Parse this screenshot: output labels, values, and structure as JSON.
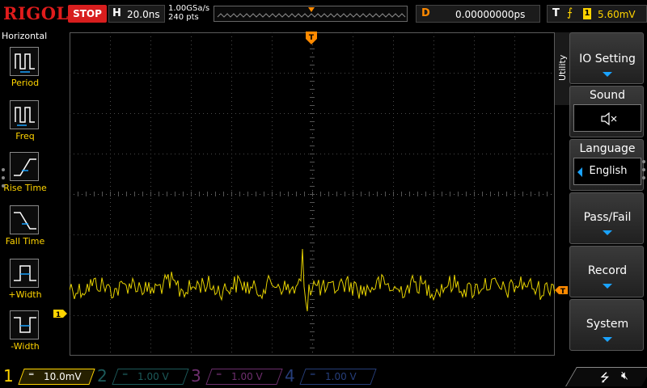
{
  "header": {
    "brand": "RIGOL",
    "run_state": "STOP",
    "horizontal": {
      "letter": "H",
      "timebase": "20.0ns"
    },
    "sample_rate": "1.00GSa/s",
    "memory_depth": "240 pts",
    "delay": {
      "letter": "D",
      "value": "0.00000000ps"
    },
    "trigger": {
      "letter": "T",
      "edge_symbol": "⨍",
      "channel": "1",
      "level": "5.60mV"
    },
    "trigger_marker": "T"
  },
  "left_menu": {
    "title": "Horizontal",
    "items": [
      {
        "id": "period",
        "label": "Period"
      },
      {
        "id": "freq",
        "label": "Freq"
      },
      {
        "id": "rise-time",
        "label": "Rise Time"
      },
      {
        "id": "fall-time",
        "label": "Fall Time"
      },
      {
        "id": "pos-width",
        "label": "+Width"
      },
      {
        "id": "neg-width",
        "label": "-Width"
      }
    ]
  },
  "markers": {
    "channel1_ground": "1",
    "trigger_level": "T"
  },
  "right_menu": {
    "tab_label": "Utility",
    "io_setting": "IO Setting",
    "sound": {
      "label": "Sound",
      "value_icon": "speaker-muted-icon"
    },
    "language": {
      "label": "Language",
      "value": "English"
    },
    "pass_fail": "Pass/Fail",
    "record": "Record",
    "system": "System"
  },
  "channels": [
    {
      "num": "1",
      "coupling": "═",
      "scale": "10.0mV"
    },
    {
      "num": "2",
      "coupling": "═",
      "scale": "1.00 V"
    },
    {
      "num": "3",
      "coupling": "═",
      "scale": "1.00 V"
    },
    {
      "num": "4",
      "coupling": "═",
      "scale": "1.00 V"
    }
  ],
  "status": {
    "usb": "⭍",
    "mute": "🔇︎"
  },
  "colors": {
    "ch1": "#ffd400",
    "ch2": "#1c5a5a",
    "ch3": "#6e2f6e",
    "ch4": "#263e7a",
    "brand": "#e01c1c",
    "trigger": "#ff8a00",
    "menu_accent": "#1aa3ff"
  }
}
